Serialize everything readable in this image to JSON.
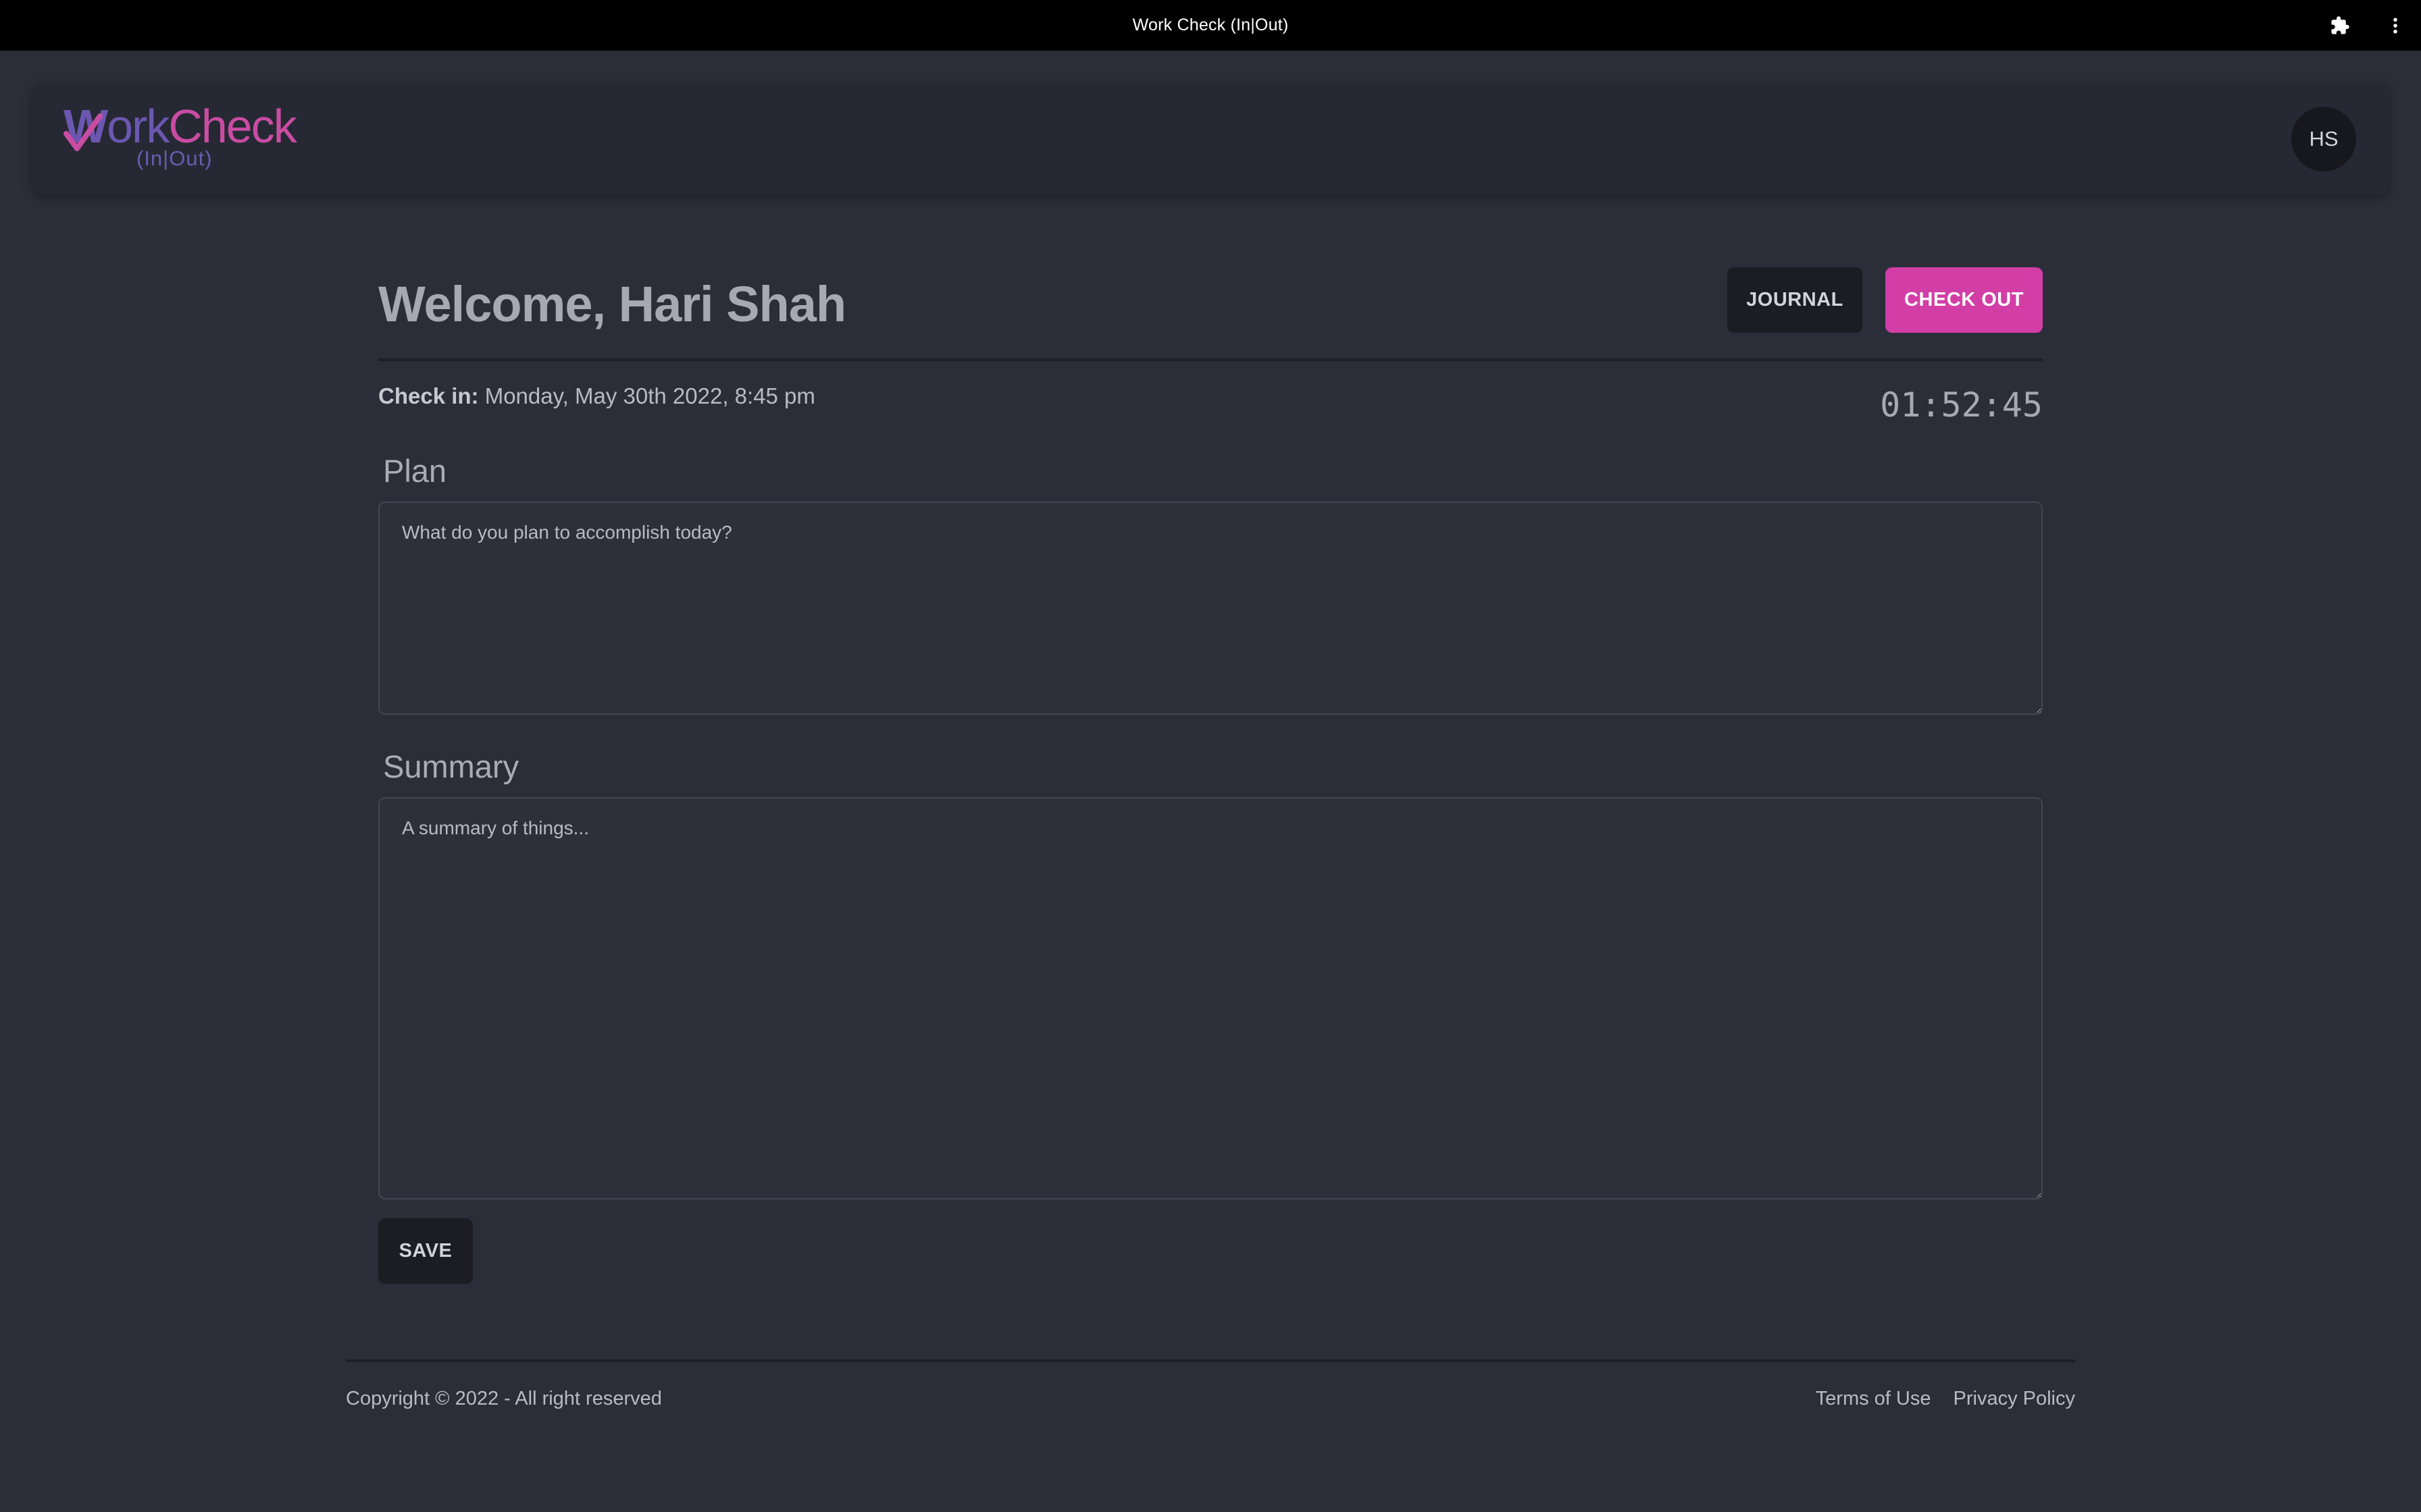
{
  "window": {
    "title": "Work Check (In|Out)",
    "icons": [
      "puzzle-icon",
      "more-vertical-icon"
    ]
  },
  "header": {
    "logo": {
      "word_left": "W",
      "word_mid": "ork",
      "word_right": "Check",
      "subtitle": "(In|Out)",
      "colors": {
        "primary": "#6b57b0",
        "accent": "#c94ca3"
      }
    },
    "avatar_initials": "HS"
  },
  "main": {
    "welcome": "Welcome, Hari Shah",
    "journal_label": "JOURNAL",
    "checkout_label": "CHECK OUT",
    "checkin_label": "Check in:",
    "checkin_value": "Monday, May 30th 2022, 8:45 pm",
    "timer": "01:52:45",
    "plan": {
      "label": "Plan",
      "placeholder": "What do you plan to accomplish today?",
      "value": ""
    },
    "summary": {
      "label": "Summary",
      "placeholder": "A summary of things...",
      "value": ""
    },
    "save_label": "SAVE"
  },
  "footer": {
    "copyright": "Copyright © 2022 - All right reserved",
    "links": [
      "Terms of Use",
      "Privacy Policy"
    ]
  },
  "colors": {
    "background": "#2b2e39",
    "header_bg": "#262933",
    "checkout_accent": "#d23ea6",
    "dark_button": "#1b1d23"
  }
}
